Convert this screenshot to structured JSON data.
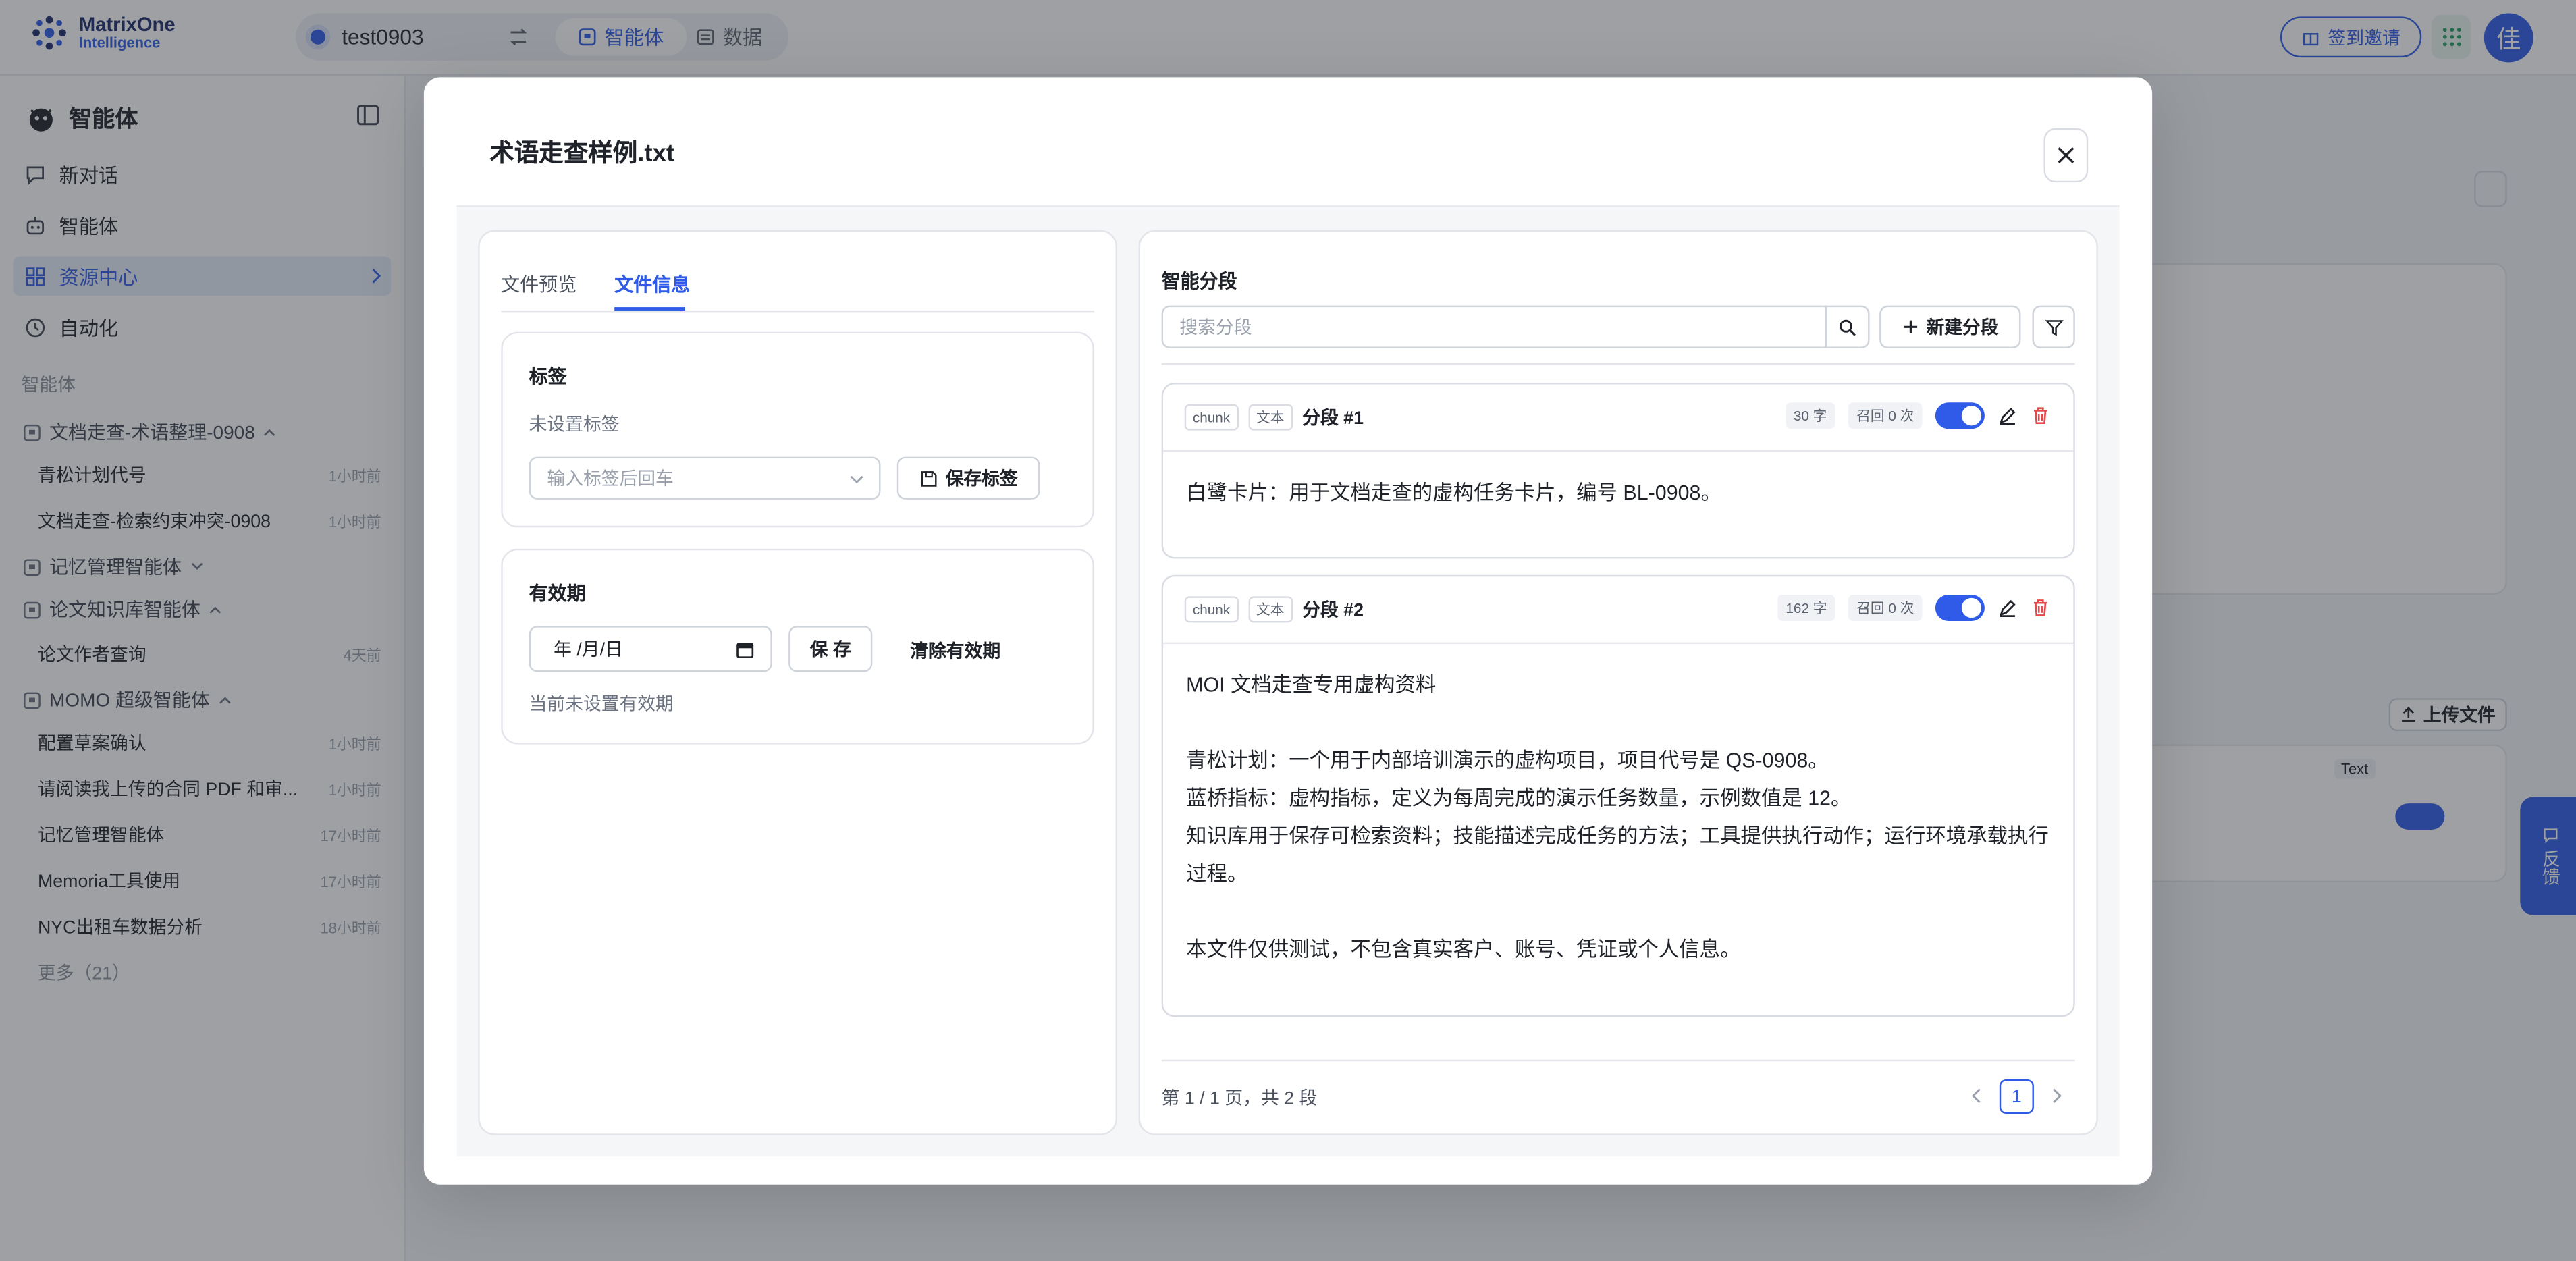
{
  "topbar": {
    "logo_line1": "MatrixOne",
    "logo_line2": "Intelligence",
    "workspace": "test0903",
    "tabs": [
      {
        "label": "智能体",
        "icon": "agent-icon"
      },
      {
        "label": "数据",
        "icon": "data-icon"
      }
    ],
    "invite_label": "签到邀请",
    "avatar_text": "佳"
  },
  "sidebar": {
    "title": "智能体",
    "nav": [
      {
        "label": "新对话",
        "icon": "new-chat-icon"
      },
      {
        "label": "智能体",
        "icon": "robot-icon"
      },
      {
        "label": "资源中心",
        "icon": "grid-icon"
      },
      {
        "label": "自动化",
        "icon": "clock-icon"
      }
    ],
    "section_label": "智能体",
    "groups": [
      {
        "label": "文档走查-术语整理-0908",
        "expanded": true,
        "items": [
          {
            "label": "青松计划代号",
            "time": "1小时前"
          },
          {
            "label": "文档走查-检索约束冲突-0908",
            "time": "1小时前"
          }
        ]
      },
      {
        "label": "记忆管理智能体",
        "expanded": false,
        "items": []
      },
      {
        "label": "论文知识库智能体",
        "expanded": true,
        "items": [
          {
            "label": "论文作者查询",
            "time": "4天前"
          }
        ]
      },
      {
        "label": "MOMO 超级智能体",
        "expanded": true,
        "items": [
          {
            "label": "配置草案确认",
            "time": "1小时前"
          },
          {
            "label": "请阅读我上传的合同 PDF 和审...",
            "time": "1小时前"
          },
          {
            "label": "记忆管理智能体",
            "time": "17小时前"
          },
          {
            "label": "Memoria工具使用",
            "time": "17小时前"
          },
          {
            "label": "NYC出租车数据分析",
            "time": "18小时前"
          }
        ]
      }
    ],
    "more_label": "更多（21）"
  },
  "background": {
    "upload_label": "上传文件",
    "text_badge": "Text"
  },
  "modal": {
    "title": "术语走查样例.txt",
    "left": {
      "tabs": [
        "文件预览",
        "文件信息"
      ],
      "active_tab": 1,
      "tags": {
        "title": "标签",
        "status": "未设置标签",
        "input_placeholder": "输入标签后回车",
        "save_label": "保存标签"
      },
      "validity": {
        "title": "有效期",
        "date_placeholder": "年 /月/日",
        "save_label": "保 存",
        "clear_label": "清除有效期",
        "status": "当前未设置有效期"
      }
    },
    "right": {
      "title": "智能分段",
      "search_placeholder": "搜索分段",
      "new_label": "新建分段",
      "segments": [
        {
          "chip1": "chunk",
          "chip2": "文本",
          "title": "分段 #1",
          "chars": "30 字",
          "recall": "召回 0 次",
          "enabled": true,
          "text": "白鹭卡片：用于文档走查的虚构任务卡片，编号 BL-0908。"
        },
        {
          "chip1": "chunk",
          "chip2": "文本",
          "title": "分段 #2",
          "chars": "162 字",
          "recall": "召回 0 次",
          "enabled": true,
          "text": "MOI 文档走查专用虚构资料\n\n青松计划：一个用于内部培训演示的虚构项目，项目代号是 QS-0908。\n蓝桥指标：虚构指标，定义为每周完成的演示任务数量，示例数值是 12。\n知识库用于保存可检索资料；技能描述完成任务的方法；工具提供执行动作；运行环境承载执行过程。\n\n本文件仅供测试，不包含真实客户、账号、凭证或个人信息。"
        }
      ],
      "pagination": {
        "summary": "第 1 / 1 页，共 2 段",
        "current": "1"
      }
    }
  },
  "feedback_label": "反馈",
  "colors": {
    "accent": "#2f5be8",
    "danger": "#e5484d"
  }
}
